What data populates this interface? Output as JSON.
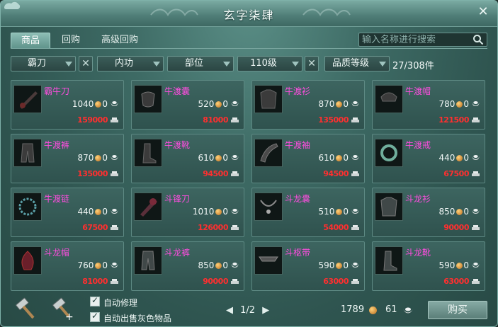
{
  "window": {
    "title": "玄字柒肆"
  },
  "tabs": [
    "商品",
    "回购",
    "高级回购"
  ],
  "search": {
    "placeholder": "输入名称进行搜索"
  },
  "filters": {
    "weapon": "霸刀",
    "skill": "内功",
    "slot": "部位",
    "level": "110级",
    "quality": "品质等级",
    "count": "27/308件"
  },
  "items": [
    {
      "name": "霸牛刀",
      "price": "1040",
      "extra": "0",
      "ref": "159000"
    },
    {
      "name": "牛渡囊",
      "price": "520",
      "extra": "0",
      "ref": "81000"
    },
    {
      "name": "牛渡衫",
      "price": "870",
      "extra": "0",
      "ref": "135000"
    },
    {
      "name": "牛渡帽",
      "price": "780",
      "extra": "0",
      "ref": "121500"
    },
    {
      "name": "牛渡裤",
      "price": "870",
      "extra": "0",
      "ref": "135000"
    },
    {
      "name": "牛渡靴",
      "price": "610",
      "extra": "0",
      "ref": "94500"
    },
    {
      "name": "牛渡袖",
      "price": "610",
      "extra": "0",
      "ref": "94500"
    },
    {
      "name": "牛渡戒",
      "price": "440",
      "extra": "0",
      "ref": "67500"
    },
    {
      "name": "牛渡链",
      "price": "440",
      "extra": "0",
      "ref": "67500"
    },
    {
      "name": "斗锋刀",
      "price": "1010",
      "extra": "0",
      "ref": "126000"
    },
    {
      "name": "斗龙囊",
      "price": "510",
      "extra": "0",
      "ref": "54000"
    },
    {
      "name": "斗龙衫",
      "price": "850",
      "extra": "0",
      "ref": "90000"
    },
    {
      "name": "斗龙帽",
      "price": "760",
      "extra": "0",
      "ref": "81000"
    },
    {
      "name": "斗龙裤",
      "price": "850",
      "extra": "0",
      "ref": "90000"
    },
    {
      "name": "斗枢带",
      "price": "590",
      "extra": "0",
      "ref": "63000"
    },
    {
      "name": "斗龙靴",
      "price": "590",
      "extra": "0",
      "ref": "63000"
    }
  ],
  "footer": {
    "auto_repair": "自动修理",
    "auto_sell_gray": "自动出售灰色物品",
    "page": "1/2",
    "prev": "◀",
    "next": "▶",
    "money_gold": "1789",
    "money_silver": "61",
    "buy_label": "购买"
  },
  "colors": {
    "item_name": "#ff4de0",
    "ref_price": "#ff2f2f",
    "accent": "#5e928a"
  }
}
